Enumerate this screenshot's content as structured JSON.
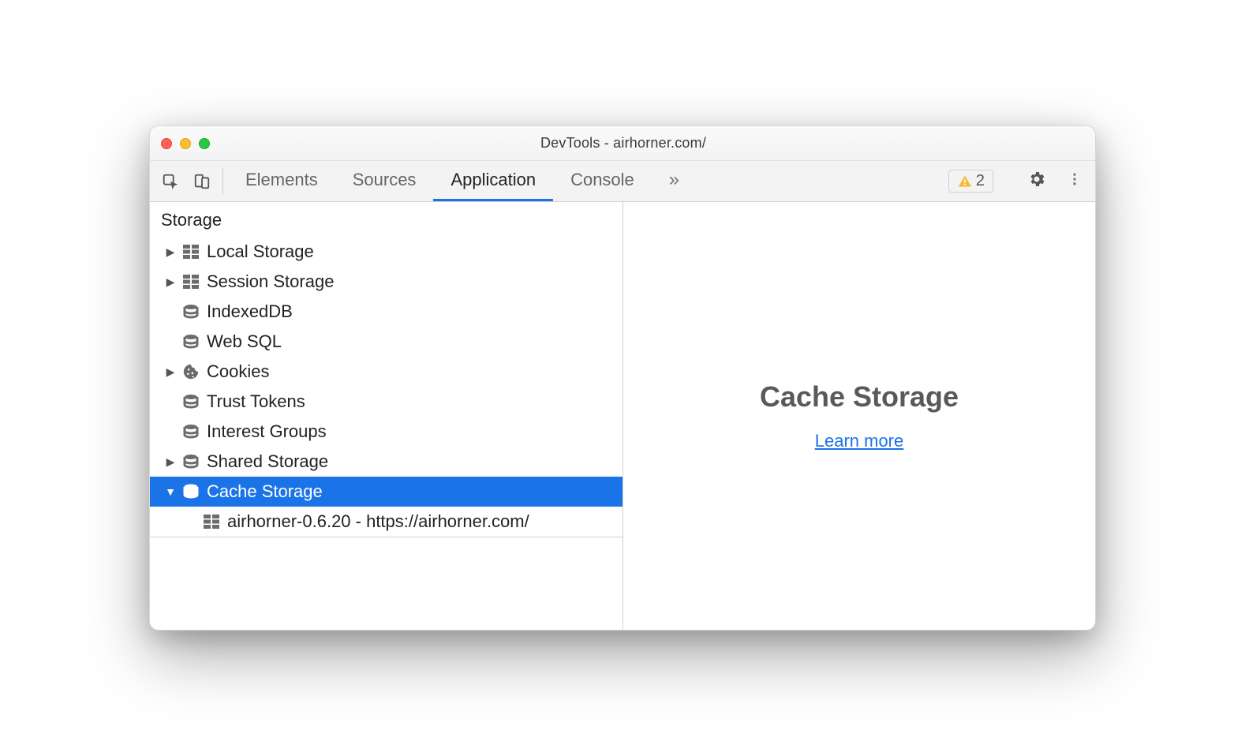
{
  "window": {
    "title": "DevTools - airhorner.com/"
  },
  "toolbar": {
    "tabs": {
      "elements": "Elements",
      "sources": "Sources",
      "application": "Application",
      "console": "Console"
    },
    "warning_count": "2"
  },
  "sidebar": {
    "section": "Storage",
    "items": {
      "local_storage": "Local Storage",
      "session_storage": "Session Storage",
      "indexeddb": "IndexedDB",
      "websql": "Web SQL",
      "cookies": "Cookies",
      "trust_tokens": "Trust Tokens",
      "interest_groups": "Interest Groups",
      "shared_storage": "Shared Storage",
      "cache_storage": "Cache Storage",
      "cache_entry": "airhorner-0.6.20 - https://airhorner.com/"
    }
  },
  "main": {
    "title": "Cache Storage",
    "link": "Learn more"
  }
}
